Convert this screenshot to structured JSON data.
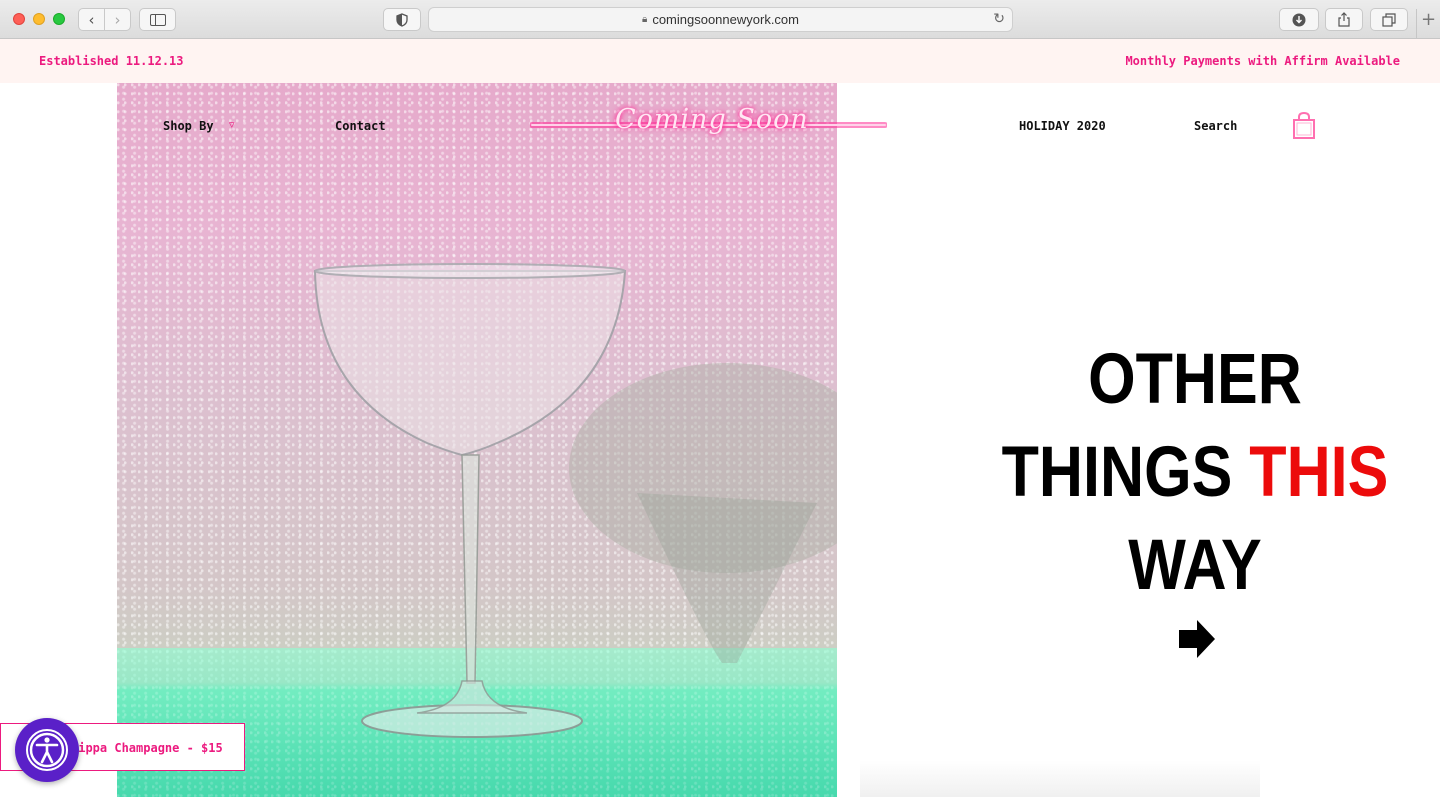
{
  "browser": {
    "url": "comingsoonnewyork.com"
  },
  "announcement": {
    "left": "Established 11.12.13",
    "right": "Monthly Payments with Affirm Available"
  },
  "nav": {
    "shop_by": "Shop By",
    "contact": "Contact",
    "logo": "Coming Soon",
    "holiday": "HOLIDAY 2020",
    "search": "Search"
  },
  "headline": {
    "line1": "OTHER",
    "line2a": "THINGS ",
    "line2b": "THIS",
    "line3": "WAY"
  },
  "promo": {
    "text": "Zippa Champagne - $15"
  },
  "colors": {
    "accent_pink": "#ec1a7f",
    "headline_red": "#ec0b0b",
    "a11y_purple": "#5a20c8"
  }
}
